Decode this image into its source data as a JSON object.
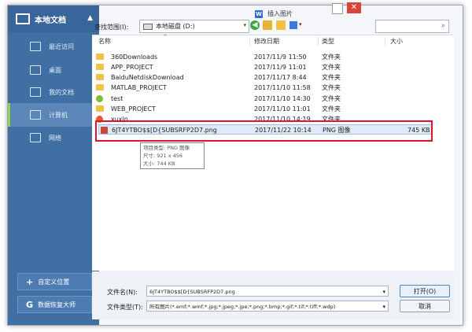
{
  "sidebar": {
    "header": "本地文档",
    "items": [
      {
        "label": "最近访问",
        "icon": "recent-icon"
      },
      {
        "label": "桌面",
        "icon": "desktop-icon"
      },
      {
        "label": "我的文档",
        "icon": "documents-icon"
      },
      {
        "label": "计算机",
        "icon": "computer-icon"
      },
      {
        "label": "网络",
        "icon": "network-icon"
      }
    ],
    "active_item": "计算机",
    "custom_location_label": "自定义位置",
    "data_recovery_label": "数据恢复大师"
  },
  "dialog": {
    "title": "插入图片",
    "minimize_symbol": "□",
    "close_symbol": "✕"
  },
  "toolbar": {
    "look_in_label": "查找范围(I):",
    "look_in_value": "本地磁盘 (D:)",
    "dropdown_symbol": "▾",
    "back_symbol": "◀",
    "search_symbol": "⌕"
  },
  "columns": {
    "name": "名称",
    "modified": "修改日期",
    "type": "类型",
    "size": "大小"
  },
  "sort_arrow": "^",
  "files": [
    {
      "name": "360Downloads",
      "modified": "2017/11/9 11:50",
      "type": "文件夹",
      "size": "",
      "kind": "folder"
    },
    {
      "name": "APP_PROJECT",
      "modified": "2017/11/9 11:01",
      "type": "文件夹",
      "size": "",
      "kind": "folder"
    },
    {
      "name": "BaiduNetdiskDownload",
      "modified": "2017/11/17 8:44",
      "type": "文件夹",
      "size": "",
      "kind": "folder"
    },
    {
      "name": "MATLAB_PROJECT",
      "modified": "2017/11/10 11:58",
      "type": "文件夹",
      "size": "",
      "kind": "folder"
    },
    {
      "name": "test",
      "modified": "2017/11/10 14:30",
      "type": "文件夹",
      "size": "",
      "kind": "test"
    },
    {
      "name": "WEB_PROJECT",
      "modified": "2017/11/10 11:01",
      "type": "文件夹",
      "size": "",
      "kind": "folder"
    },
    {
      "name": "xuxin",
      "modified": "2017/11/10 14:19",
      "type": "文件夹",
      "size": "",
      "kind": "xuxin"
    },
    {
      "name": "6JT4YTBO$$[D{SUBSRFP2D7.png",
      "modified": "2017/11/22 10:14",
      "type": "PNG 图像",
      "size": "745 KB",
      "kind": "png"
    }
  ],
  "tooltip": {
    "line1": "项目类型: PNG 图像",
    "line2": "尺寸: 921 x 456",
    "line3": "大小: 744 KB"
  },
  "bottom": {
    "filename_label": "文件名(N):",
    "filename_value": "6JT4YTBO$$[D{SUBSRFP2D7.png",
    "filetype_label": "文件类型(T):",
    "filetype_value": "所有图片(*.emf;*.wmf;*.jpg;*.jpeg;*.jpe;*.png;*.bmp;*.gif;*.tif;*.tiff;*.wdp)",
    "open_label": "打开(O)",
    "cancel_label": "取消"
  },
  "colors": {
    "sidebar_bg": "#3f6fa3",
    "active_accent": "#8ed24a",
    "highlight_box": "#e0142e",
    "close_button": "#d9433a"
  }
}
